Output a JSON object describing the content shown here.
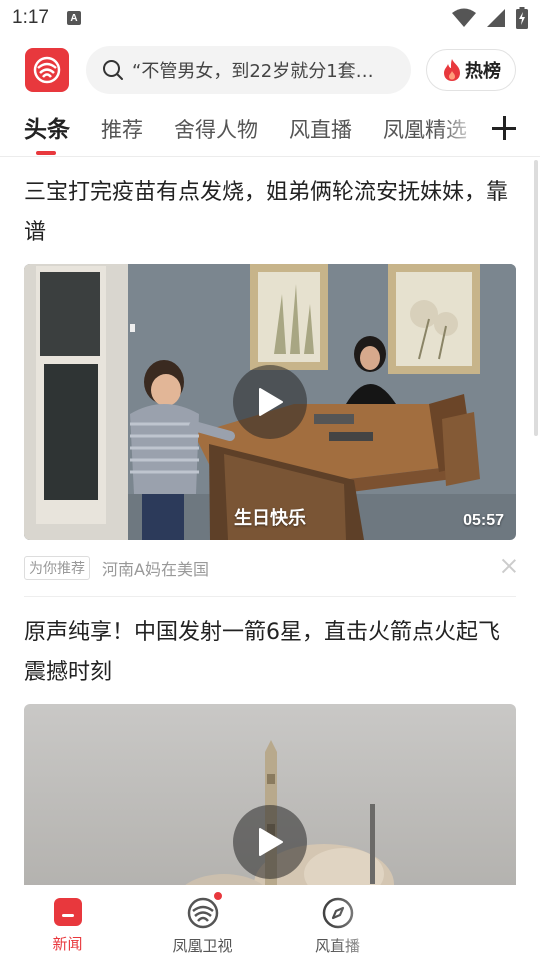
{
  "status_bar": {
    "time": "1:17",
    "notification_icon": "a-icon",
    "icons": [
      "wifi-icon",
      "signal-icon",
      "battery-icon"
    ]
  },
  "header": {
    "logo_icon": "phoenix-logo-icon",
    "search": {
      "placeholder": "“不管男女，到22岁就分1套…"
    },
    "hot_button": {
      "label": "热榜",
      "icon": "flame-icon",
      "color": "#e8383d"
    }
  },
  "tabs": {
    "items": [
      {
        "label": "头条",
        "active": true
      },
      {
        "label": "推荐",
        "active": false
      },
      {
        "label": "舍得人物",
        "active": false
      },
      {
        "label": "风直播",
        "active": false
      },
      {
        "label": "凤凰精选",
        "active": false
      }
    ],
    "add_icon": "plus-icon"
  },
  "feed": {
    "cards": [
      {
        "title": "三宝打完疫苗有点发烧，姐弟俩轮流安抚妹妹，靠谱",
        "video_caption": "生日快乐",
        "duration": "05:57",
        "tag": "为你推荐",
        "source": "河南A妈在美国"
      },
      {
        "title": "原声纯享！中国发射一箭6星，直击火箭点火起飞震撼时刻"
      }
    ]
  },
  "bottom_nav": {
    "items": [
      {
        "label": "新闻",
        "icon": "news-icon",
        "active": true
      },
      {
        "label": "凤凰卫视",
        "icon": "phoenix-tv-icon",
        "active": false,
        "badge": true
      },
      {
        "label": "风直播",
        "icon": "compass-icon",
        "active": false
      }
    ]
  },
  "colors": {
    "accent": "#e8383d",
    "text": "#222222",
    "muted": "#999999"
  }
}
